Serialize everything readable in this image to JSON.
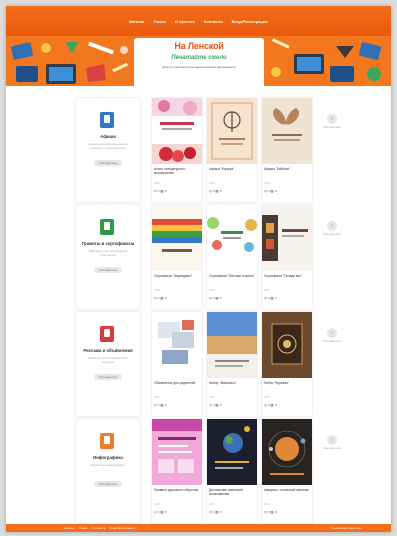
{
  "nav": {
    "items": [
      "Каталог",
      "Поиск",
      "О проекте",
      "Контакты",
      "Вход/Регистрация"
    ]
  },
  "banner": {
    "logo_title": "На Ленской",
    "logo_line": "—",
    "tagline": "Печатайте смело",
    "subtitle": "каталог шаблонов для педагогической деятельности"
  },
  "sections": [
    {
      "title": "Афиши",
      "desc": "Афиши для информирования учеников о мероприятиях",
      "button": "Смотреть все",
      "icon": "poster-icon",
      "color": "#2f79c6",
      "items": [
        {
          "title": "Анонс литературного мероприятия",
          "meta": "2020",
          "stats": "👁 8   ⬇ 16"
        },
        {
          "title": "Афиша \"Музыка\"",
          "meta": "2020",
          "stats": "👁 8   ⬇ 16"
        },
        {
          "title": "Афиша \"Бабочки\"",
          "meta": "2020",
          "stats": "👁 8   ⬇ 16"
        }
      ],
      "more": "Смотреть все"
    },
    {
      "title": "Грамоты и сертификаты",
      "desc": "Шаблоны для награждения участников",
      "button": "Смотреть все",
      "icon": "certificate-icon",
      "color": "#2e9a47",
      "items": [
        {
          "title": "Сертификат \"Карандаши\"",
          "meta": "2020",
          "stats": "👁 8   ⬇ 16"
        },
        {
          "title": "Сертификат \"Листики и цветы\"",
          "meta": "2020",
          "stats": "👁 8   ⬇ 16"
        },
        {
          "title": "Сертификат \"Позади все\"",
          "meta": "2020",
          "stats": "👁 8   ⬇ 16"
        }
      ],
      "more": "Смотреть все"
    },
    {
      "title": "Реклама и объявления",
      "desc": "Шаблоны для объявлений и рекламы",
      "button": "Смотреть все",
      "icon": "megaphone-icon",
      "color": "#d93a3a",
      "items": [
        {
          "title": "Объявление для родителей",
          "meta": "2020",
          "stats": "👁 8   ⬇ 16"
        },
        {
          "title": "Набор \"Живопись\"",
          "meta": "2020",
          "stats": "👁 8   ⬇ 16"
        },
        {
          "title": "Набор \"Кружево\"",
          "meta": "2020",
          "stats": "👁 8   ⬇ 16"
        }
      ],
      "more": "Смотреть все"
    },
    {
      "title": "Инфографика",
      "desc": "Шаблоны инфографики",
      "button": "Смотреть все",
      "icon": "chart-icon",
      "color": "#ee7d2a",
      "items": [
        {
          "title": "Правила дорожного обучения",
          "meta": "2020",
          "stats": "👁 8   ⬇ 16"
        },
        {
          "title": "Достижения советской космонавтики",
          "meta": "2020",
          "stats": "👁 8   ⬇ 16"
        },
        {
          "title": "Акварель: солнечной системы",
          "meta": "2020",
          "stats": "👁 8   ⬇ 16"
        }
      ],
      "more": "Смотреть все"
    }
  ],
  "footer": {
    "links": [
      "Каталог",
      "Поиск",
      "О проекте",
      "Вход/Регистрация"
    ],
    "right": "Сделано для педагогов"
  },
  "colors": {
    "accent": "#f36d1a",
    "banner": "#f2771f",
    "logo": "#e8540e",
    "tagline": "#3ea55e"
  }
}
